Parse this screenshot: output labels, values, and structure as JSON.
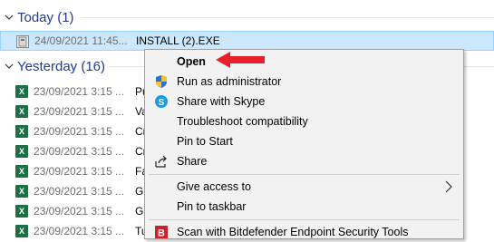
{
  "groups": {
    "today": {
      "title": "Today (1)"
    },
    "yesterday": {
      "title": "Yesterday (16)"
    }
  },
  "today_files": [
    {
      "date": "24/09/2021 11:45...",
      "name": "INSTALL (2).EXE",
      "icon": "exe-installer-icon",
      "selected": true
    }
  ],
  "yesterday_files": [
    {
      "date": "23/09/2021 3:15 ...",
      "name": "Pu",
      "icon": "excel-file-icon"
    },
    {
      "date": "23/09/2021 3:15 ...",
      "name": "Va",
      "icon": "excel-file-icon"
    },
    {
      "date": "23/09/2021 3:15 ...",
      "name": "Cr",
      "icon": "excel-file-icon"
    },
    {
      "date": "23/09/2021 3:15 ...",
      "name": "Cr",
      "icon": "excel-file-icon"
    },
    {
      "date": "23/09/2021 3:15 ...",
      "name": "Fa",
      "icon": "excel-file-icon"
    },
    {
      "date": "23/09/2021 3:15 ...",
      "name": "Gr",
      "icon": "excel-file-icon"
    },
    {
      "date": "23/09/2021 3:15 ...",
      "name": "Gr",
      "icon": "excel-file-icon"
    },
    {
      "date": "23/09/2021 3:15 ...",
      "name": "Tu",
      "icon": "excel-file-icon"
    }
  ],
  "context_menu": {
    "open": "Open",
    "run_as_admin": "Run as administrator",
    "share_skype": "Share with Skype",
    "troubleshoot": "Troubleshoot compatibility",
    "pin_start": "Pin to Start",
    "share": "Share",
    "give_access": "Give access to",
    "pin_taskbar": "Pin to taskbar",
    "bitdefender": "Scan with Bitdefender Endpoint Security Tools"
  },
  "colors": {
    "selection_bg": "#cce8ff",
    "group_title": "#1e3d8f",
    "annotation_arrow": "#e8202a"
  }
}
